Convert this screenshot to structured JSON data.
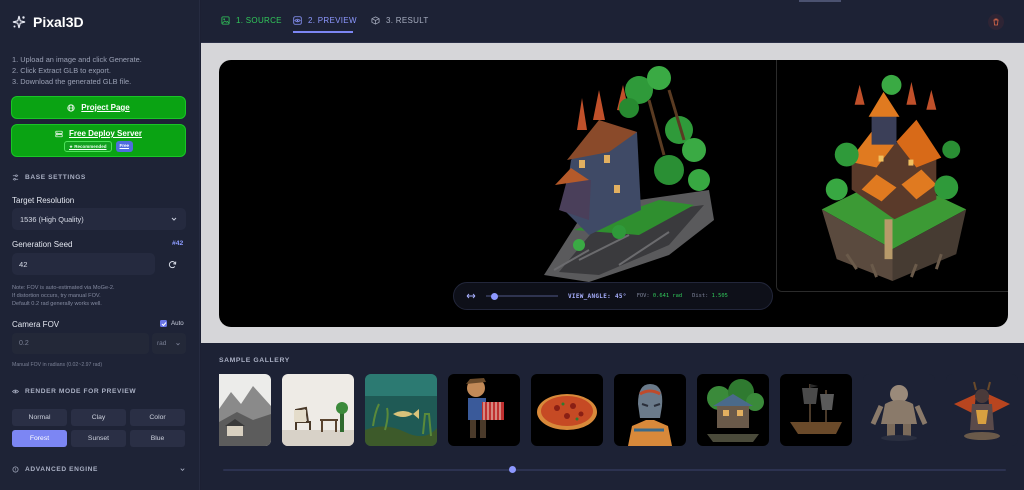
{
  "app": {
    "name": "Pixal3D"
  },
  "instructions": [
    "1. Upload an image and click Generate.",
    "2. Click Extract GLB to export.",
    "3. Download the generated GLB file."
  ],
  "links": {
    "project_page": "Project Page",
    "deploy_server": "Free Deploy Server",
    "badge_recommended": "★ Recommended",
    "badge_free": "Free"
  },
  "base_settings": {
    "title": "BASE SETTINGS",
    "resolution_label": "Target Resolution",
    "resolution_value": "1536 (High Quality)",
    "seed_label": "Generation Seed",
    "seed_tag": "#42",
    "seed_value": "42",
    "note": [
      "Note: FOV is auto-estimated via MoGe-2.",
      "If distortion occurs, try manual FOV.",
      "Default 0.2 rad generally works well."
    ],
    "fov_label": "Camera FOV",
    "auto_label": "Auto",
    "auto_checked": true,
    "fov_placeholder": "0.2",
    "fov_unit": "rad",
    "fov_hint": "Manual FOV in radians (0.02~2.97 rad)"
  },
  "render_mode": {
    "title": "RENDER MODE FOR PREVIEW",
    "modes": [
      "Normal",
      "Clay",
      "Color",
      "Forest",
      "Sunset",
      "Blue"
    ],
    "active": "Forest"
  },
  "advanced": {
    "title": "ADVANCED ENGINE"
  },
  "tabs": {
    "source": "1. SOURCE",
    "preview": "2. PREVIEW",
    "result": "3. RESULT",
    "active": "preview"
  },
  "viewer": {
    "view_angle": "VIEW_ANGLE: 45°",
    "fov_prefix": "FOV:",
    "fov_value": "0.641 rad",
    "dist_prefix": "Dist:",
    "dist_value": "1.505",
    "slider_fraction": 0.12
  },
  "gallery": {
    "title": "SAMPLE GALLERY",
    "items": [
      "ink-landscape",
      "chair-room",
      "underwater-fish",
      "accordion-player",
      "pizza",
      "stone-bust",
      "treehouse",
      "pirate-ship",
      "yeti",
      "dragon-knight"
    ],
    "scroll_fraction": 0.37
  },
  "colors": {
    "accent": "#7c86f3",
    "green_button": "#0aa313",
    "source_tab": "#31c85a",
    "background": "#1c2033"
  }
}
